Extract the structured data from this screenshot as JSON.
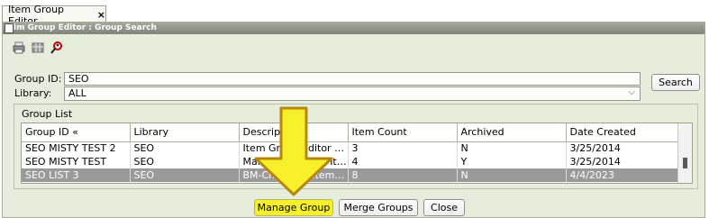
{
  "tab": {
    "label": "Item Group Editor",
    "close_symbol": "×"
  },
  "window": {
    "title": "ı̇m Group Editor : Group Search"
  },
  "toolbar": {
    "icons": [
      "print-icon",
      "columns-icon",
      "search-person-icon"
    ]
  },
  "form": {
    "group_id_label": "Group ID:",
    "group_id_value": "SEO",
    "library_label": "Library:",
    "library_value": "ALL",
    "search_label": "Search"
  },
  "group_list": {
    "title": "Group List",
    "columns": [
      "Group ID «",
      "Library",
      "Descripti...",
      "Item Count",
      "Archived",
      "Date Created"
    ],
    "rows": [
      [
        "SEO MISTY TEST 2",
        "SEO",
        "Item Group Editor pra...",
        "3",
        "N",
        "3/25/2014"
      ],
      [
        "SEO MISTY TEST",
        "SEO",
        "March 25 Testing Item ...",
        "4",
        "Y",
        "3/25/2014"
      ],
      [
        "SEO LIST 3",
        "SEO",
        "BM-Changing Item t...",
        "8",
        "N",
        "4/4/2023"
      ]
    ],
    "selected_row_index": 2
  },
  "buttons": {
    "manage": "Manage Group",
    "merge": "Merge Groups",
    "close": "Close"
  },
  "colors": {
    "highlight": "#f6f02a",
    "arrow_fill": "#f6f02a",
    "arrow_stroke": "#b8860b",
    "selection": "#9a9a9a"
  }
}
